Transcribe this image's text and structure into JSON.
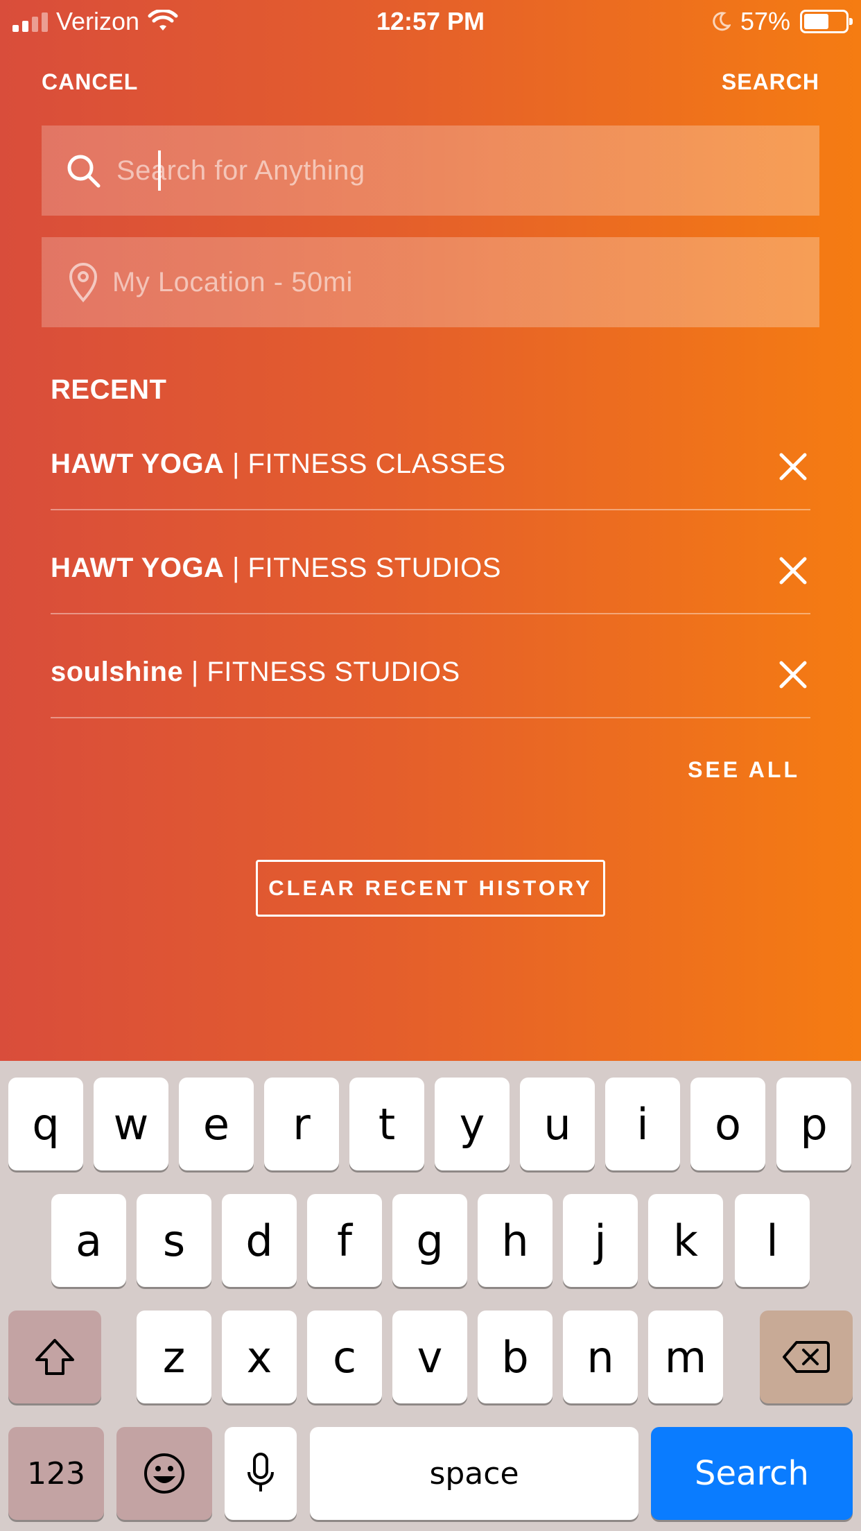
{
  "status_bar": {
    "carrier": "Verizon",
    "time": "12:57 PM",
    "battery": "57%",
    "battery_level": 0.57
  },
  "nav": {
    "cancel": "CANCEL",
    "search": "SEARCH"
  },
  "search": {
    "placeholder": "Search for Anything",
    "location_placeholder": "My Location - 50mi"
  },
  "recent": {
    "title": "RECENT",
    "items": [
      {
        "name": "HAWT YOGA",
        "category": " | FITNESS CLASSES"
      },
      {
        "name": "HAWT YOGA",
        "category": " | FITNESS STUDIOS"
      },
      {
        "name": "soulshine",
        "category": " | FITNESS STUDIOS"
      }
    ],
    "see_all": "SEE ALL",
    "clear_history": "CLEAR RECENT HISTORY"
  },
  "keyboard": {
    "row1": [
      "q",
      "w",
      "e",
      "r",
      "t",
      "y",
      "u",
      "i",
      "o",
      "p"
    ],
    "row2": [
      "a",
      "s",
      "d",
      "f",
      "g",
      "h",
      "j",
      "k",
      "l"
    ],
    "row3": [
      "z",
      "x",
      "c",
      "v",
      "b",
      "n",
      "m"
    ],
    "numbers_key": "123",
    "space_key": "space",
    "search_key": "Search"
  },
  "colors": {
    "gradient_start": "#d94d3b",
    "gradient_end": "#f57c12",
    "search_key": "#0a7cff"
  }
}
